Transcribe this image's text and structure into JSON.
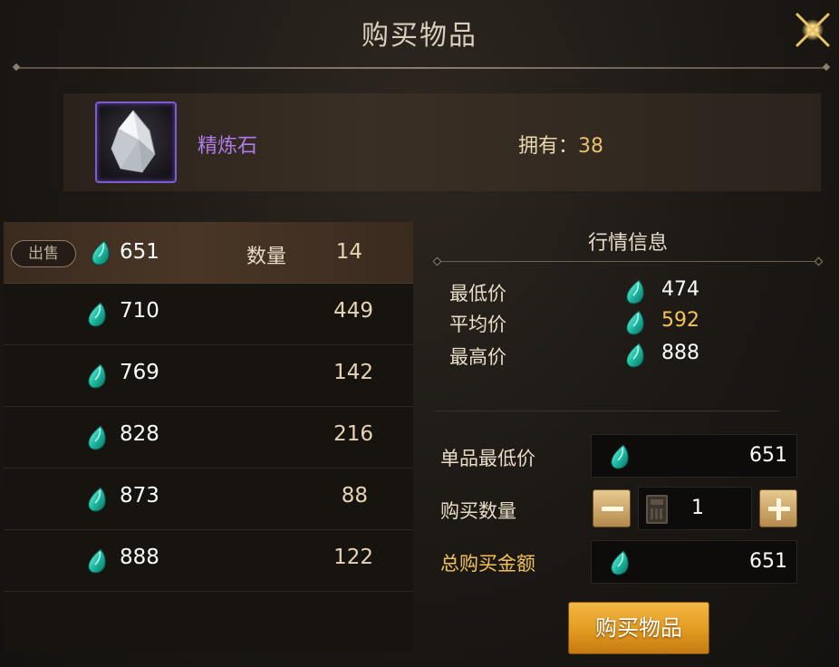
{
  "title": "购买物品",
  "item": {
    "name": "精炼石",
    "owned_label": "拥有：",
    "owned_count": "38"
  },
  "listings": {
    "sell_badge": "出售",
    "quantity_label": "数量",
    "rows": [
      {
        "price": "651",
        "qty": "14"
      },
      {
        "price": "710",
        "qty": "449"
      },
      {
        "price": "769",
        "qty": "142"
      },
      {
        "price": "828",
        "qty": "216"
      },
      {
        "price": "873",
        "qty": "88"
      },
      {
        "price": "888",
        "qty": "122"
      }
    ]
  },
  "market": {
    "title": "行情信息",
    "min_label": "最低价",
    "min_value": "474",
    "avg_label": "平均价",
    "avg_value": "592",
    "max_label": "最高价",
    "max_value": "888"
  },
  "form": {
    "unit_price_label": "单品最低价",
    "unit_price_value": "651",
    "quantity_label": "购买数量",
    "quantity_value": "1",
    "total_label": "总购买金额",
    "total_value": "651"
  },
  "buy_button": "购买物品",
  "colors": {
    "item_name": "#b07bea",
    "accent_gold": "#f1c35a",
    "button": "#e29a20"
  },
  "icons": {
    "currency": "teal-gem-icon",
    "close": "close-icon",
    "minus": "minus-icon",
    "plus": "plus-icon",
    "calculator": "calculator-icon",
    "item": "refining-stone-icon"
  }
}
